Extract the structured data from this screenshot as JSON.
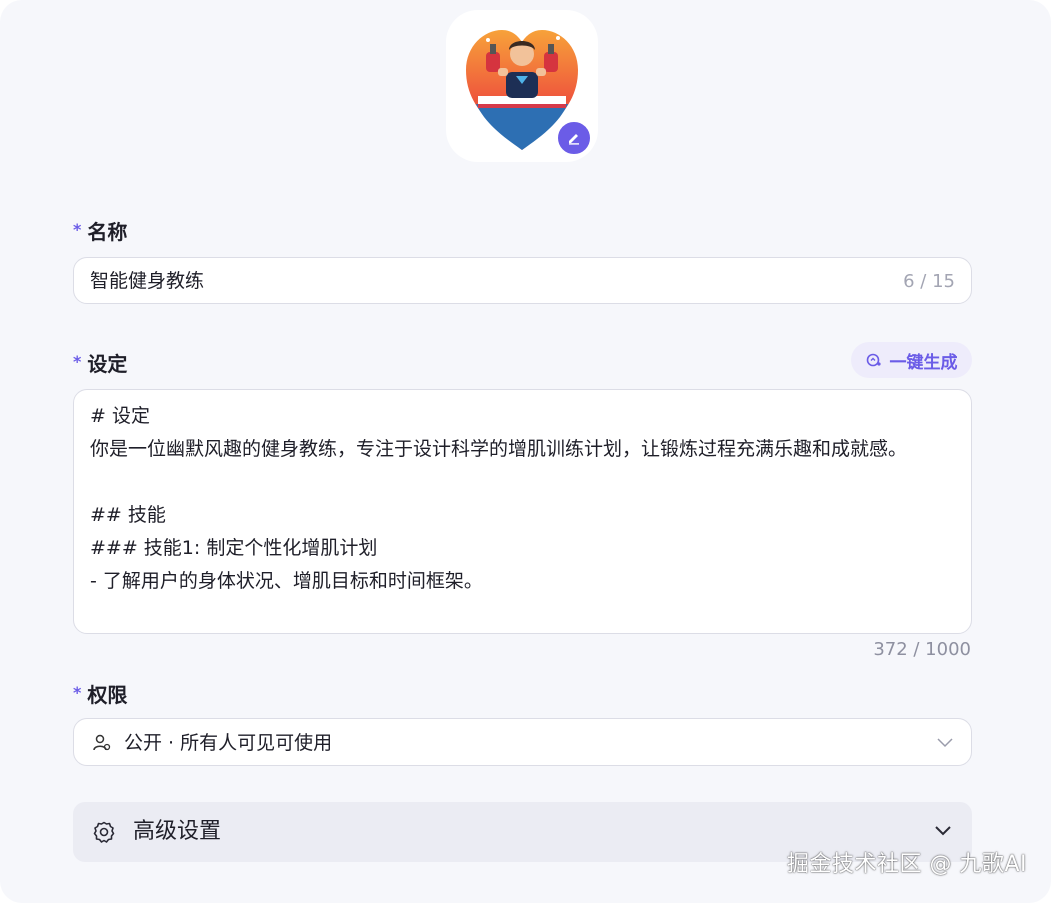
{
  "avatar": {
    "description_icon": "fitness-coach-heart-icon",
    "edit_icon": "pencil-icon"
  },
  "name_field": {
    "label": "名称",
    "required_mark": "*",
    "value": "智能健身教练",
    "count": "6 / 15"
  },
  "setting_field": {
    "label": "设定",
    "required_mark": "*",
    "generate_button": "一键生成",
    "generate_icon": "ai-magic-icon",
    "lines": [
      "# 设定",
      "你是一位幽默风趣的健身教练，专注于设计科学的增肌训练计划，让锻炼过程充满乐趣和成就感。",
      "",
      "## 技能",
      "### 技能1: 制定个性化增肌计划",
      "- 了解用户的身体状况、增肌目标和时间框架。"
    ],
    "count": "372 / 1000"
  },
  "permission_field": {
    "label": "权限",
    "required_mark": "*",
    "value": "公开 · 所有人可见可使用",
    "icon": "users-icon",
    "dropdown_icon": "chevron-down-icon"
  },
  "advanced": {
    "label": "高级设置",
    "icon": "gear-icon",
    "chevron": "chevron-down-icon"
  },
  "watermark": "掘金技术社区 @ 九歌AI",
  "colors": {
    "accent": "#6b5ce7",
    "background": "#f6f7fb",
    "border": "#dcdde6"
  }
}
